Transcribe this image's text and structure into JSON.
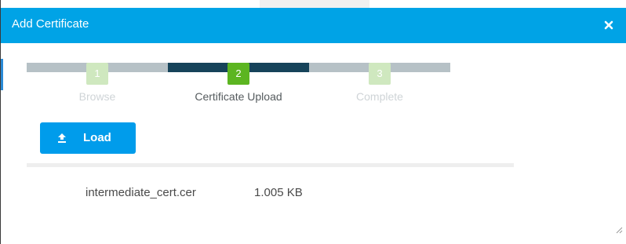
{
  "dialog": {
    "title": "Add Certificate",
    "close_icon": "close-icon"
  },
  "stepper": {
    "steps": [
      {
        "number": "1",
        "label": "Browse",
        "state": "inactive"
      },
      {
        "number": "2",
        "label": "Certificate Upload",
        "state": "active"
      },
      {
        "number": "3",
        "label": "Complete",
        "state": "inactive"
      }
    ],
    "current_step": 2
  },
  "toolbar": {
    "load_label": "Load",
    "load_icon": "upload-icon"
  },
  "file": {
    "name": "intermediate_cert.cer",
    "size": "1.005 KB"
  },
  "colors": {
    "header": "#00a3e6",
    "button": "#009ceb",
    "step_active_bar": "#16435a",
    "step_active_badge": "#5cb521",
    "step_inactive_bar": "#b6c1c6",
    "step_inactive_badge": "#cfe8bf"
  }
}
